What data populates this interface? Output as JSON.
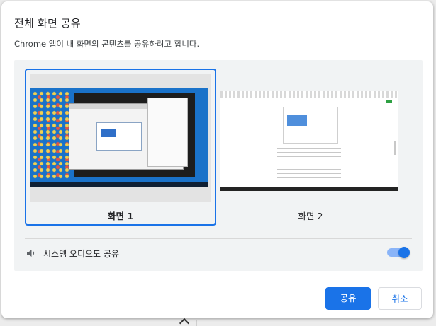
{
  "dialog": {
    "title": "전체 화면 공유",
    "subtitle": "Chrome 앱이 내 화면의 콘텐츠를 공유하려고 합니다."
  },
  "screens": [
    {
      "label": "화면 1",
      "selected": true
    },
    {
      "label": "화면 2",
      "selected": false
    }
  ],
  "audio": {
    "label": "시스템 오디오도 공유",
    "enabled": true,
    "icon": "speaker-icon"
  },
  "buttons": {
    "share_label": "공유",
    "cancel_label": "취소"
  },
  "colors": {
    "accent": "#1a73e8",
    "toggle_track": "#8ab4f8",
    "panel_bg": "#f1f3f4"
  }
}
